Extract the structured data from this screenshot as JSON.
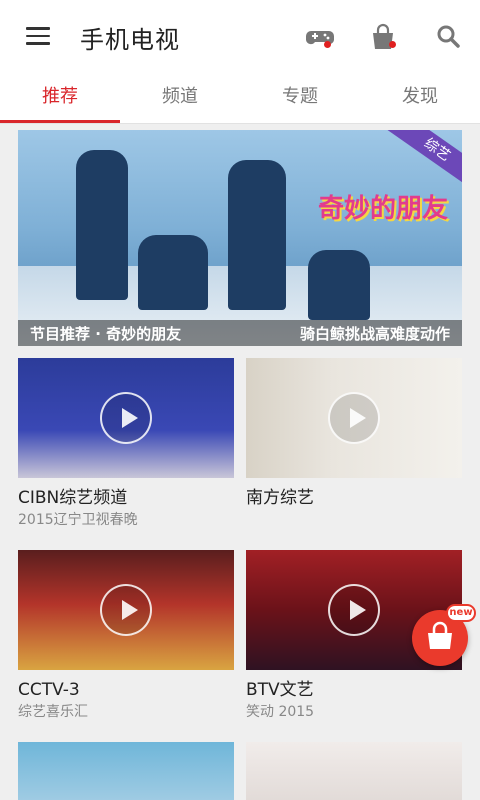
{
  "header": {
    "title": "手机电视",
    "icons": [
      "menu-icon",
      "gamepad-icon",
      "shopping-bag-icon",
      "search-icon"
    ]
  },
  "tabs": [
    {
      "label": "推荐",
      "active": true
    },
    {
      "label": "频道",
      "active": false
    },
    {
      "label": "专题",
      "active": false
    },
    {
      "label": "发现",
      "active": false
    }
  ],
  "banner": {
    "corner_tag": "综艺",
    "logo_text": "奇妙的朋友",
    "caption_left": "节目推荐 · 奇妙的朋友",
    "caption_right": "骑白鲸挑战高难度动作"
  },
  "cards": [
    {
      "title": "CIBN综艺频道",
      "subtitle": "2015辽宁卫视春晚"
    },
    {
      "title": "南方综艺",
      "subtitle": ""
    },
    {
      "title": "CCTV-3",
      "subtitle": "综艺喜乐汇"
    },
    {
      "title": "BTV文艺",
      "subtitle": "笑动 2015"
    }
  ],
  "fab": {
    "badge": "new",
    "icon": "shopping-bag-icon"
  },
  "colors": {
    "accent": "#d9262b",
    "fab": "#ea3a2c"
  }
}
